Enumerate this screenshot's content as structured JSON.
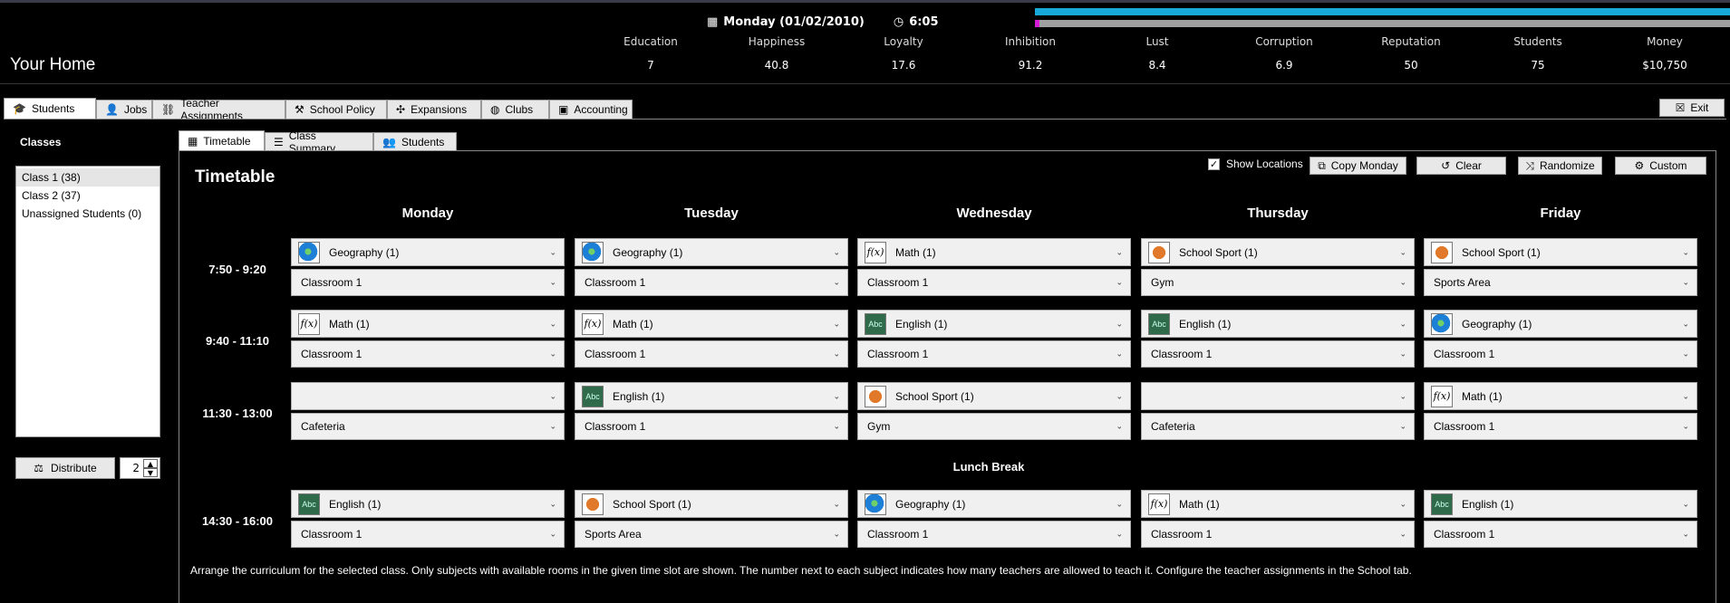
{
  "header": {
    "date": "Monday (01/02/2010)",
    "time": "6:05",
    "location": "Your Home",
    "stats": [
      {
        "label": "Education",
        "value": "7"
      },
      {
        "label": "Happiness",
        "value": "40.8"
      },
      {
        "label": "Loyalty",
        "value": "17.6"
      },
      {
        "label": "Inhibition",
        "value": "91.2"
      },
      {
        "label": "Lust",
        "value": "8.4"
      },
      {
        "label": "Corruption",
        "value": "6.9"
      },
      {
        "label": "Reputation",
        "value": "50"
      },
      {
        "label": "Students",
        "value": "75"
      },
      {
        "label": "Money",
        "value": "$10,750"
      }
    ],
    "colors": {
      "bar_top": "#16a9d9",
      "bar_bottom": "#a0a0a0",
      "bar_bottom_fill": "#d61bd8"
    }
  },
  "main_tabs": [
    "Students",
    "Jobs",
    "Teacher Assignments",
    "School Policy",
    "Expansions",
    "Clubs",
    "Accounting"
  ],
  "exit_label": "Exit",
  "classes": {
    "title": "Classes",
    "items": [
      "Class 1 (38)",
      "Class 2 (37)",
      "Unassigned Students (0)"
    ],
    "distribute_label": "Distribute",
    "distribute_count": "2"
  },
  "sub_tabs": [
    "Timetable",
    "Class Summary",
    "Students"
  ],
  "timetable": {
    "title": "Timetable",
    "show_locations_label": "Show Locations",
    "buttons": {
      "copy_monday": "Copy Monday",
      "clear": "Clear",
      "randomize": "Randomize",
      "custom": "Custom"
    },
    "days": [
      "Monday",
      "Tuesday",
      "Wednesday",
      "Thursday",
      "Friday"
    ],
    "lunch_label": "Lunch Break",
    "slots": [
      {
        "time": "7:50 - 9:20",
        "cells": [
          {
            "subject": "Geography (1)",
            "icon": "globe",
            "room": "Classroom 1"
          },
          {
            "subject": "Geography (1)",
            "icon": "globe",
            "room": "Classroom 1"
          },
          {
            "subject": "Math (1)",
            "icon": "fx",
            "room": "Classroom 1"
          },
          {
            "subject": "School Sport (1)",
            "icon": "sport",
            "room": "Gym"
          },
          {
            "subject": "School Sport (1)",
            "icon": "sport",
            "room": "Sports Area"
          }
        ]
      },
      {
        "time": "9:40 - 11:10",
        "cells": [
          {
            "subject": "Math (1)",
            "icon": "fx",
            "room": "Classroom 1"
          },
          {
            "subject": "Math (1)",
            "icon": "fx",
            "room": "Classroom 1"
          },
          {
            "subject": "English (1)",
            "icon": "abc",
            "room": "Classroom 1"
          },
          {
            "subject": "English (1)",
            "icon": "abc",
            "room": "Classroom 1"
          },
          {
            "subject": "Geography (1)",
            "icon": "globe",
            "room": "Classroom 1"
          }
        ]
      },
      {
        "time": "11:30 - 13:00",
        "cells": [
          {
            "subject": "",
            "icon": "",
            "room": "Cafeteria"
          },
          {
            "subject": "English (1)",
            "icon": "abc",
            "room": "Classroom 1"
          },
          {
            "subject": "School Sport (1)",
            "icon": "sport",
            "room": "Gym"
          },
          {
            "subject": "",
            "icon": "",
            "room": "Cafeteria"
          },
          {
            "subject": "Math (1)",
            "icon": "fx",
            "room": "Classroom 1"
          }
        ]
      },
      {
        "time": "14:30 - 16:00",
        "cells": [
          {
            "subject": "English (1)",
            "icon": "abc",
            "room": "Classroom 1"
          },
          {
            "subject": "School Sport (1)",
            "icon": "sport",
            "room": "Sports Area"
          },
          {
            "subject": "Geography (1)",
            "icon": "globe",
            "room": "Classroom 1"
          },
          {
            "subject": "Math (1)",
            "icon": "fx",
            "room": "Classroom 1"
          },
          {
            "subject": "English (1)",
            "icon": "abc",
            "room": "Classroom 1"
          }
        ]
      }
    ],
    "help": "Arrange the curriculum for the selected class. Only subjects with available rooms in the given time slot are shown. The number next to each subject indicates how many teachers are allowed to teach it. Configure the teacher assignments in the School tab."
  }
}
